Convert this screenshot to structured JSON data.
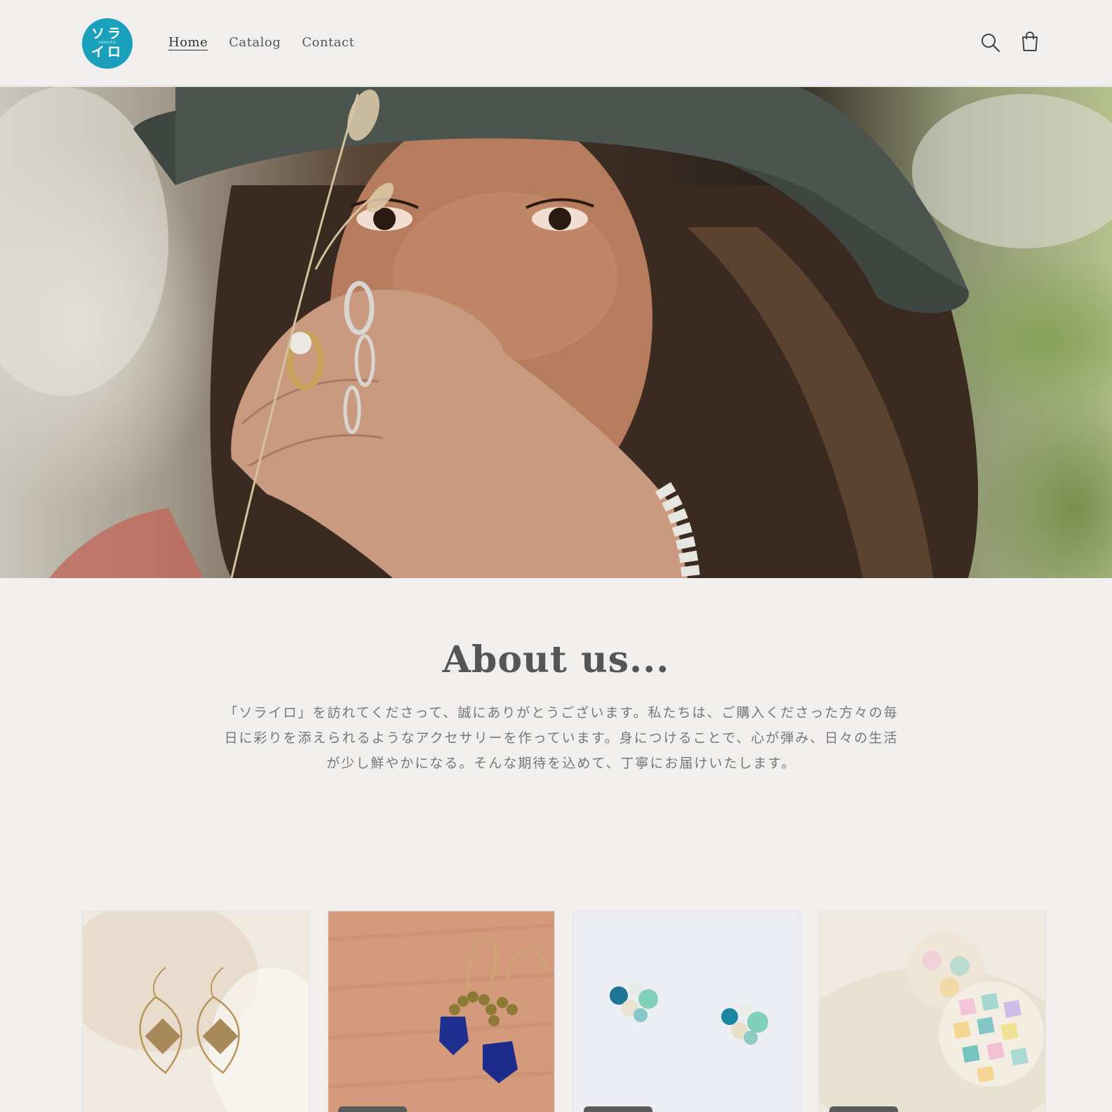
{
  "header": {
    "logo": {
      "line1": "ソラ",
      "subtext": "SORAIRO",
      "line2": "イロ",
      "accent": "#1aa0bb"
    },
    "nav": [
      {
        "label": "Home",
        "active": true
      },
      {
        "label": "Catalog",
        "active": false
      },
      {
        "label": "Contact",
        "active": false
      }
    ],
    "icons": [
      "search-icon",
      "cart-icon"
    ]
  },
  "hero": {
    "image": "woman-with-rings-bucket-hat"
  },
  "about": {
    "title": "About us...",
    "text": "「ソライロ」を訪れてくださって、誠にありがとうございます。私たちは、ご購入くださった方々の毎日に彩りを添えられるようなアクセサリーを作っています。身につけることで、心が弾み、日々の生活が少し鮮やかになる。そんな期待を込めて、丁寧にお届けいたします。"
  },
  "products": [
    {
      "image": "gold-diamond-hoop-earrings"
    },
    {
      "image": "lapis-gold-bead-earrings",
      "badge": true
    },
    {
      "image": "crystal-cluster-earrings",
      "badge": true
    },
    {
      "image": "mosaic-shell-ball-earrings",
      "badge": true
    }
  ]
}
